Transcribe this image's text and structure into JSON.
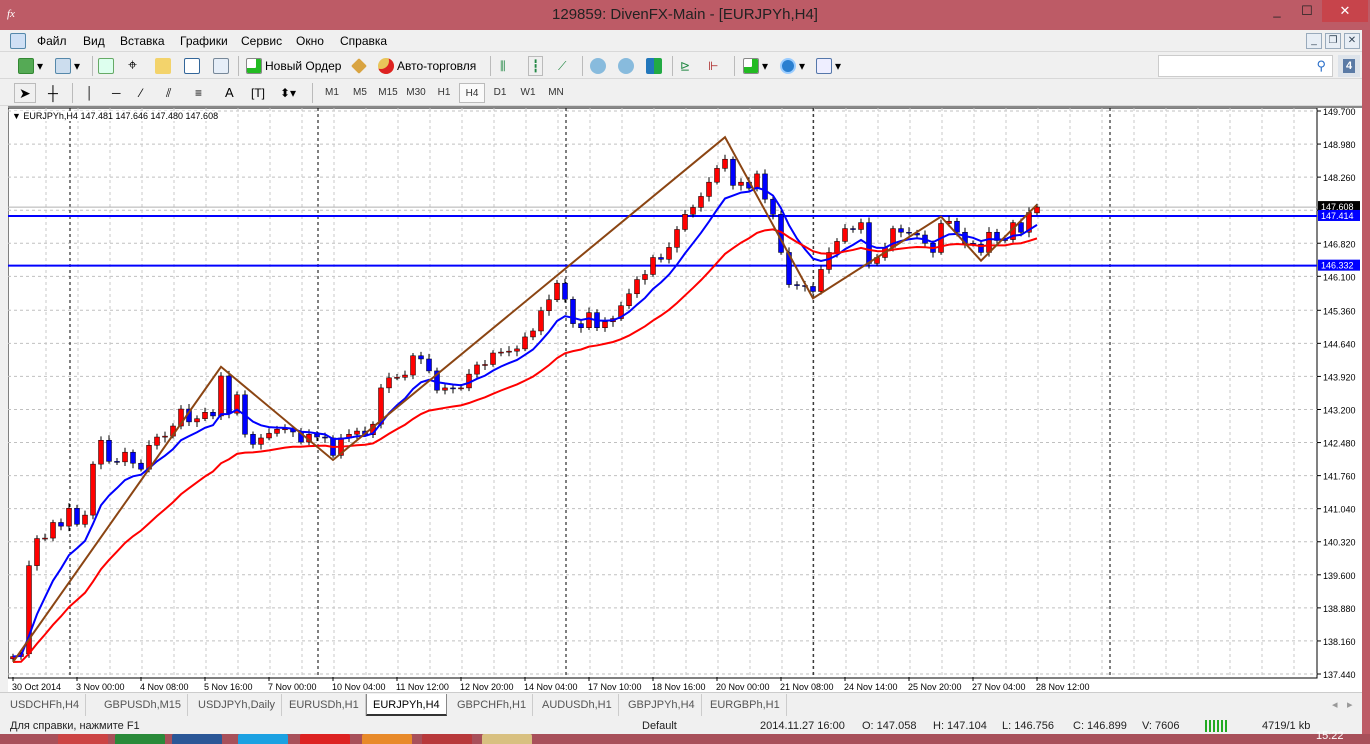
{
  "window": {
    "title": "129859: DivenFX-Main - [EURJPYh,H4]",
    "app_icon": "fx",
    "minimize": "_",
    "maximize": "☐",
    "close": "✕"
  },
  "menu": [
    "Файл",
    "Вид",
    "Вставка",
    "Графики",
    "Сервис",
    "Окно",
    "Справка"
  ],
  "toolbar": {
    "new_order": "Новый Ордер",
    "auto_trading": "Авто-торговля",
    "search_placeholder": "",
    "badge": "4"
  },
  "timeframes": [
    "M1",
    "M5",
    "M15",
    "M30",
    "H1",
    "H4",
    "D1",
    "W1",
    "MN"
  ],
  "active_timeframe": "H4",
  "chart": {
    "header": "EURJPYh,H4  147.481 147.646 147.480 147.608",
    "bull_color": "#ff0000",
    "bear_color": "#0000ff",
    "price_ticks": [
      "149.700",
      "148.980",
      "148.260",
      "147.540",
      "146.820",
      "146.100",
      "145.360",
      "144.640",
      "143.920",
      "143.200",
      "142.480",
      "141.760",
      "141.040",
      "140.320",
      "139.600",
      "138.880",
      "138.160",
      "137.440"
    ],
    "ylim": [
      137.44,
      149.7
    ],
    "time_labels": [
      "30 Oct 2014",
      "3 Nov 00:00",
      "4 Nov 08:00",
      "5 Nov 16:00",
      "7 Nov 00:00",
      "10 Nov 04:00",
      "11 Nov 12:00",
      "12 Nov 20:00",
      "14 Nov 04:00",
      "17 Nov 10:00",
      "18 Nov 16:00",
      "20 Nov 00:00",
      "21 Nov 08:00",
      "24 Nov 14:00",
      "25 Nov 20:00",
      "27 Nov 04:00",
      "28 Nov 12:00"
    ],
    "last_open": 147.481,
    "closes": [
      137.82,
      137.88,
      139.8,
      140.39,
      140.4,
      140.74,
      140.66,
      141.05,
      140.7,
      140.9,
      142.01,
      142.53,
      142.07,
      142.06,
      142.27,
      142.03,
      141.9,
      142.42,
      142.6,
      142.62,
      142.84,
      143.21,
      142.93,
      143.0,
      143.14,
      143.06,
      143.93,
      143.12,
      143.52,
      142.66,
      142.44,
      142.58,
      142.68,
      142.77,
      142.78,
      142.71,
      142.49,
      142.66,
      142.6,
      142.58,
      142.2,
      142.58,
      142.66,
      142.73,
      142.65,
      142.88,
      143.67,
      143.89,
      143.9,
      143.95,
      144.37,
      144.3,
      144.04,
      143.62,
      143.67,
      143.66,
      143.67,
      143.97,
      144.17,
      144.18,
      144.43,
      144.45,
      144.47,
      144.52,
      144.78,
      144.91,
      145.35,
      145.59,
      145.95,
      145.6,
      145.07,
      144.98,
      145.31,
      144.98,
      145.11,
      145.18,
      145.46,
      145.72,
      146.03,
      146.14,
      146.51,
      146.47,
      146.73,
      147.12,
      147.45,
      147.6,
      147.84,
      148.15,
      148.45,
      148.65,
      148.08,
      148.15,
      148.02,
      148.33,
      147.78,
      147.45,
      146.62,
      145.92,
      145.9,
      145.88,
      145.77,
      146.25,
      146.62,
      146.86,
      147.14,
      147.12,
      147.27,
      146.38,
      146.51,
      146.73,
      147.14,
      147.06,
      147.04,
      147.0,
      146.82,
      146.62,
      147.25,
      147.3,
      147.06,
      146.82,
      146.8,
      146.62,
      147.06,
      146.88,
      146.9,
      147.27,
      147.06,
      147.49,
      147.608
    ],
    "zigzag": [
      [
        0,
        137.7
      ],
      [
        26,
        144.13
      ],
      [
        40,
        142.1
      ],
      [
        89,
        149.13
      ],
      [
        100,
        145.62
      ],
      [
        116,
        147.4
      ],
      [
        121,
        146.44
      ],
      [
        128,
        147.66
      ]
    ],
    "hlines": [
      {
        "price": 147.414,
        "label": "147.414",
        "color": "#0000ff"
      },
      {
        "price": 146.332,
        "label": "146.332",
        "color": "#0000ff"
      }
    ],
    "bid": {
      "price": 147.608,
      "label": "147.608"
    },
    "ma_fast_color": "#0000ff",
    "ma_slow_color": "#ff0000",
    "zigzag_color": "#8b4513"
  },
  "tabs": [
    "USDCHFh,H4",
    "GBPUSDh,M15",
    "USDJPYh,Daily",
    "EURUSDh,H1",
    "EURJPYh,H4",
    "GBPCHFh,H1",
    "AUDUSDh,H1",
    "GBPJPYh,H4",
    "EURGBPh,H1"
  ],
  "active_tab": "EURJPYh,H4",
  "status": {
    "help": "Для справки, нажмите F1",
    "profile": "Default",
    "datetime": "2014.11.27 16:00",
    "open": "O: 147.058",
    "high": "H: 147.104",
    "low": "L: 146.756",
    "close": "C: 146.899",
    "volume": "V: 7606",
    "traffic": "4719/1 kb"
  },
  "clock": "15:22"
}
